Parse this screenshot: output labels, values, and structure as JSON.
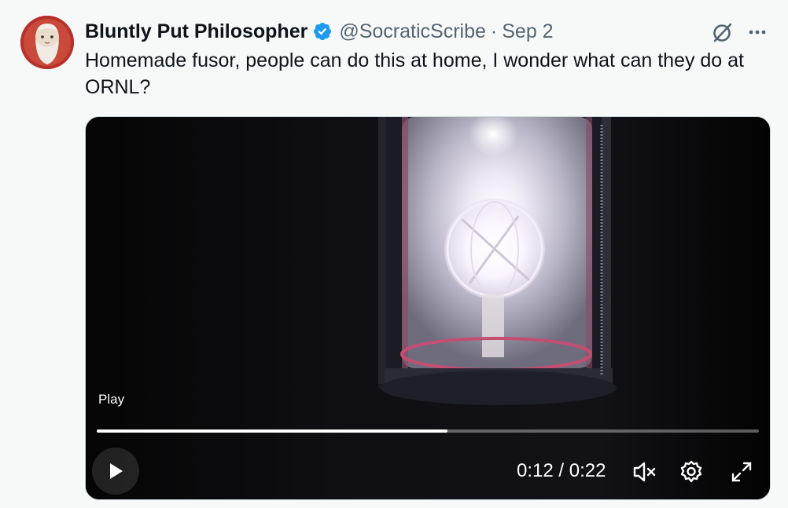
{
  "tweet": {
    "author": {
      "display_name": "Bluntly Put Philosopher",
      "handle": "@SocraticScribe",
      "verified": true,
      "avatar_icon": "philosopher-avatar"
    },
    "separator": "·",
    "date": "Sep 2",
    "text": "Homemade fusor, people can do this at home, I wonder what can they do at ORNL?",
    "actions": {
      "grok_icon": "grok-icon",
      "more_icon": "more-icon"
    }
  },
  "video": {
    "play_label": "Play",
    "progress_fraction": 0.53,
    "current_time": "0:12",
    "time_separator": "/",
    "duration": "0:22",
    "time_display": "0:12 / 0:22",
    "muted": true,
    "controls": [
      "play-icon",
      "mute-icon",
      "settings-icon",
      "fullscreen-icon"
    ]
  },
  "colors": {
    "verified_badge": "#1d9bf0",
    "secondary_text": "#536471",
    "primary_text": "#0f1419",
    "background": "#f7f9f9"
  }
}
